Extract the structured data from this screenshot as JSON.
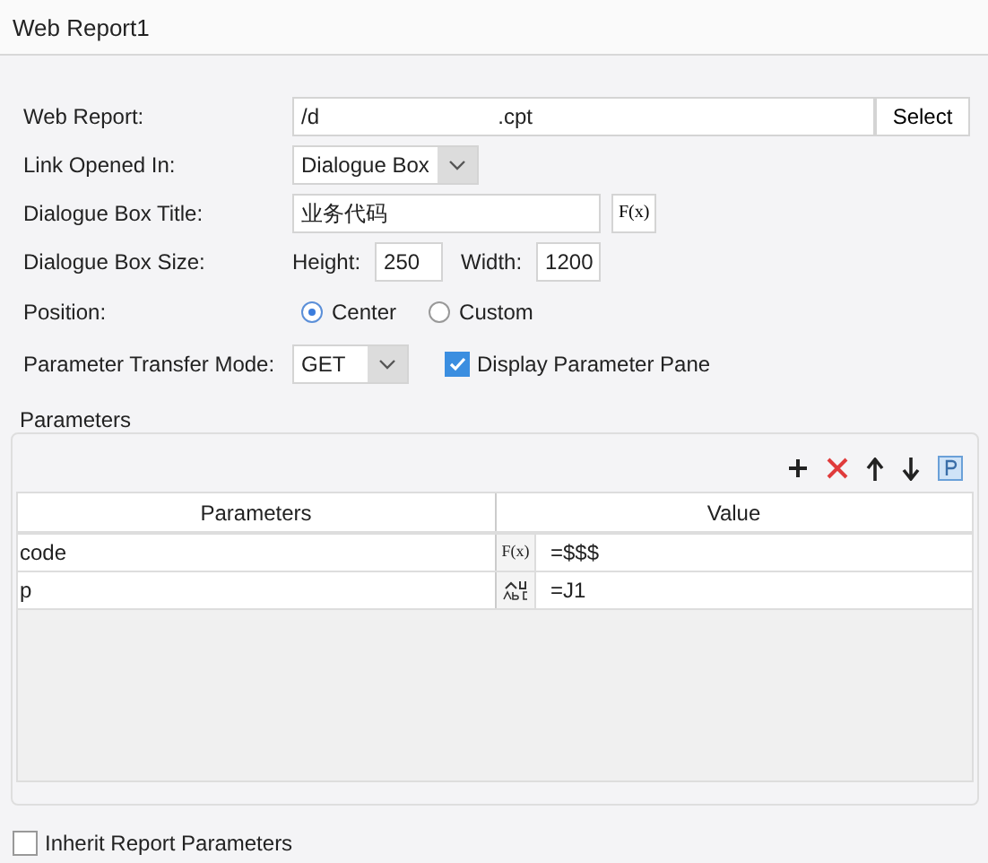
{
  "title": "Web Report1",
  "form": {
    "web_report_label": "Web Report:",
    "web_report_value_start": "/d",
    "web_report_value_end": ".cpt",
    "select_button": "Select",
    "link_label": "Link Opened In:",
    "link_value": "Dialogue Box",
    "title_label": "Dialogue Box Title:",
    "title_value": "业务代码",
    "formula_button": "F(x)",
    "size_label": "Dialogue Box Size:",
    "height_label": "Height:",
    "height_value": "250",
    "width_label": "Width:",
    "width_value": "1200",
    "position_label": "Position:",
    "positions": [
      {
        "label": "Center",
        "selected": true
      },
      {
        "label": "Custom",
        "selected": false
      }
    ],
    "mode_label": "Parameter Transfer Mode:",
    "mode_value": "GET",
    "display_pane": {
      "label": "Display Parameter Pane",
      "checked": true
    }
  },
  "parameters": {
    "title": "Parameters",
    "columns": [
      "Parameters",
      "Value"
    ],
    "rows": [
      {
        "name": "code",
        "kind": "formula",
        "type_label": "F(x)",
        "value": "=$$$"
      },
      {
        "name": "p",
        "kind": "text",
        "value": "=J1"
      }
    ]
  },
  "inherit": {
    "label": "Inherit Report Parameters",
    "checked": false
  }
}
